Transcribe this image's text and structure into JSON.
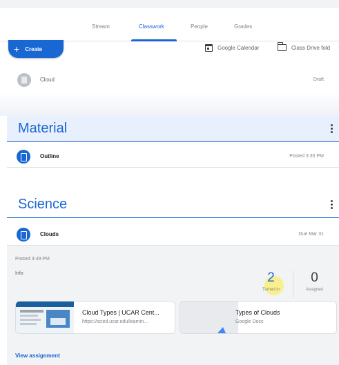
{
  "nav": {
    "tabs": [
      "Stream",
      "Classwork",
      "People",
      "Grades"
    ],
    "active_tab": "Classwork"
  },
  "toolbar": {
    "create_label": "Create",
    "calendar_label": "Google Calendar",
    "drive_label": "Class Drive fold"
  },
  "draft": {
    "title": "Cloud",
    "status": "Draft"
  },
  "topics": [
    {
      "title": "Material",
      "items": [
        {
          "title": "Outline",
          "meta": "Posted 3:35 PM",
          "icon": "material-icon"
        }
      ]
    },
    {
      "title": "Science",
      "items": [
        {
          "title": "Clouds",
          "meta": "Due Mar 31",
          "icon": "assignment-icon"
        }
      ]
    }
  ],
  "assignment": {
    "posted": "Posted 3:49 PM",
    "info_label": "Info",
    "turned_in_count": "2",
    "turned_in_label": "Turned in",
    "assigned_count": "0",
    "assigned_label": "Assigned",
    "attachments": [
      {
        "title": "Cloud Types | UCAR Cent...",
        "subtitle": "https://scied.ucar.edu/learnin..."
      },
      {
        "title": "Types of Clouds",
        "subtitle": "Google Docs"
      }
    ],
    "view_label": "View assignment"
  },
  "colors": {
    "accent": "#1967d2",
    "topic_header_bg": "#e8f0fe",
    "expanded_bg": "#f1f3f4",
    "highlight": "#ffeb3b"
  }
}
